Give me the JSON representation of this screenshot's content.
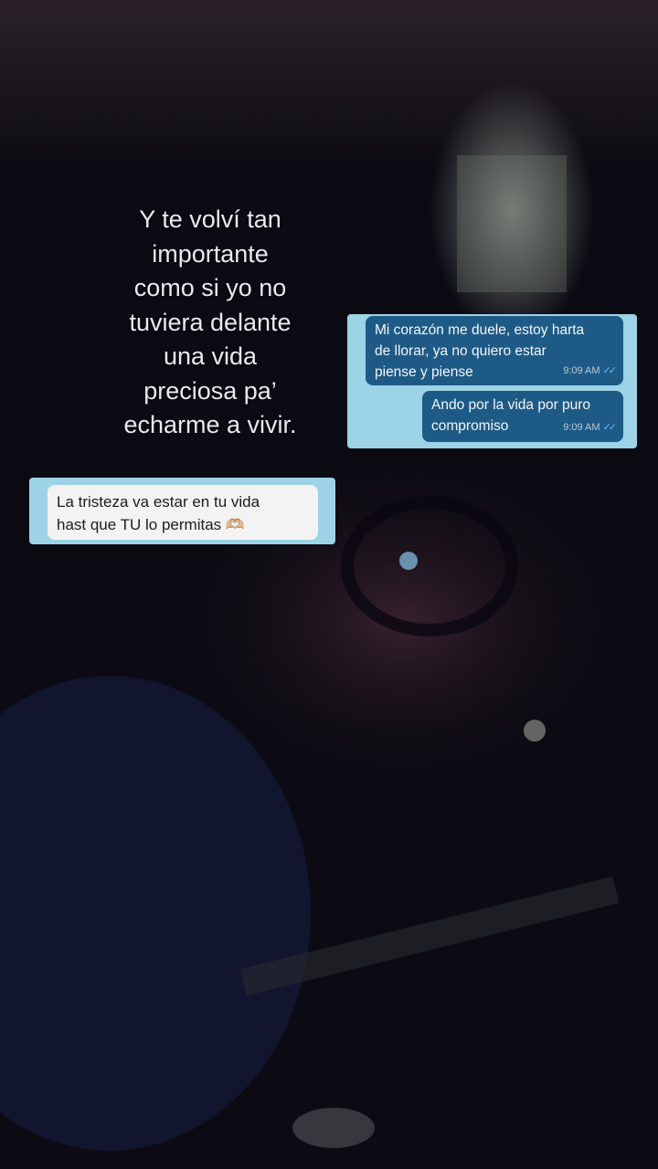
{
  "caption": {
    "lines": [
      "Y te volví tan",
      "importante",
      "como si yo no",
      "tuviera delante",
      "una vida",
      "preciosa pa’",
      "echarme a vivir."
    ]
  },
  "chat_right": {
    "messages": [
      {
        "text_lines": [
          "Mi corazón me duele, estoy harta",
          "de llorar, ya no quiero estar",
          "piense y piense"
        ],
        "time": "9:09 AM",
        "ticks": "✓✓"
      },
      {
        "text_lines": [
          "Ando por la vida por puro",
          "compromiso"
        ],
        "time": "9:09 AM",
        "ticks": "✓✓"
      }
    ]
  },
  "chat_left": {
    "message_lines": [
      "La tristeza va estar en tu vida",
      "hast que TU lo permitas 🫶🏼"
    ]
  },
  "colors": {
    "screenshot_bg": "#9cd3e6",
    "sent_bubble": "#1e5a86",
    "received_bubble": "#f3f3f3",
    "caption_text": "#e9e9ee"
  }
}
